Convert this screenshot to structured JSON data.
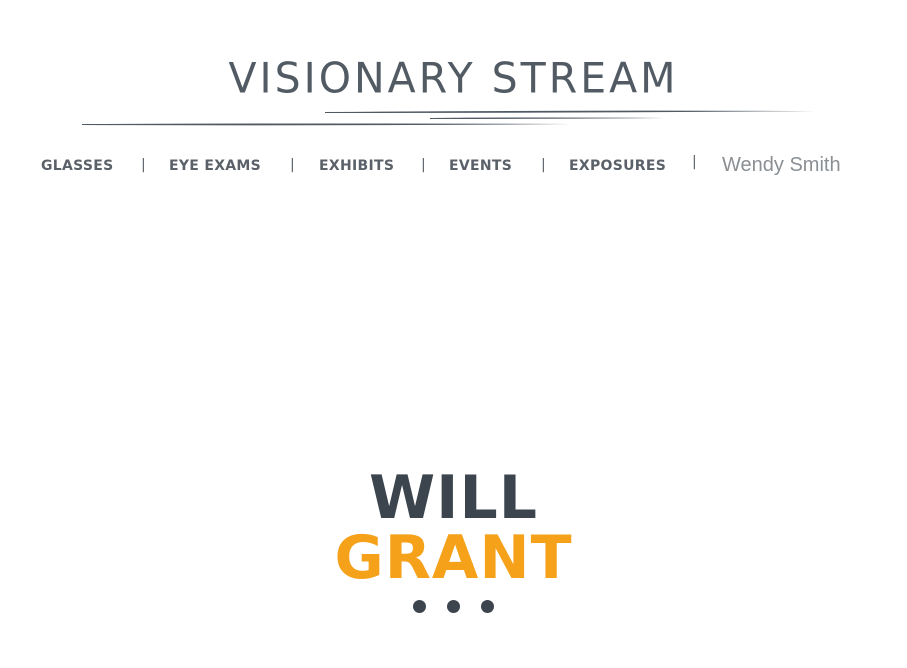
{
  "brand": {
    "logo_text": "VISIONARY STREAM"
  },
  "nav": {
    "items": [
      {
        "label": "GLASSES"
      },
      {
        "label": "EYE EXAMS"
      },
      {
        "label": "EXHIBITS"
      },
      {
        "label": "EVENTS"
      },
      {
        "label": "EXPOSURES"
      }
    ],
    "separator": "|",
    "user_name": "Wendy Smith"
  },
  "hero": {
    "first_name": "WILL",
    "last_name": "GRANT",
    "dots_icon": "ellipsis-icon"
  },
  "colors": {
    "logo": "#525b64",
    "nav_text": "#5a6168",
    "user_name": "#8a8f94",
    "hero_dark": "#3c454e",
    "accent_orange": "#f5a11a"
  }
}
